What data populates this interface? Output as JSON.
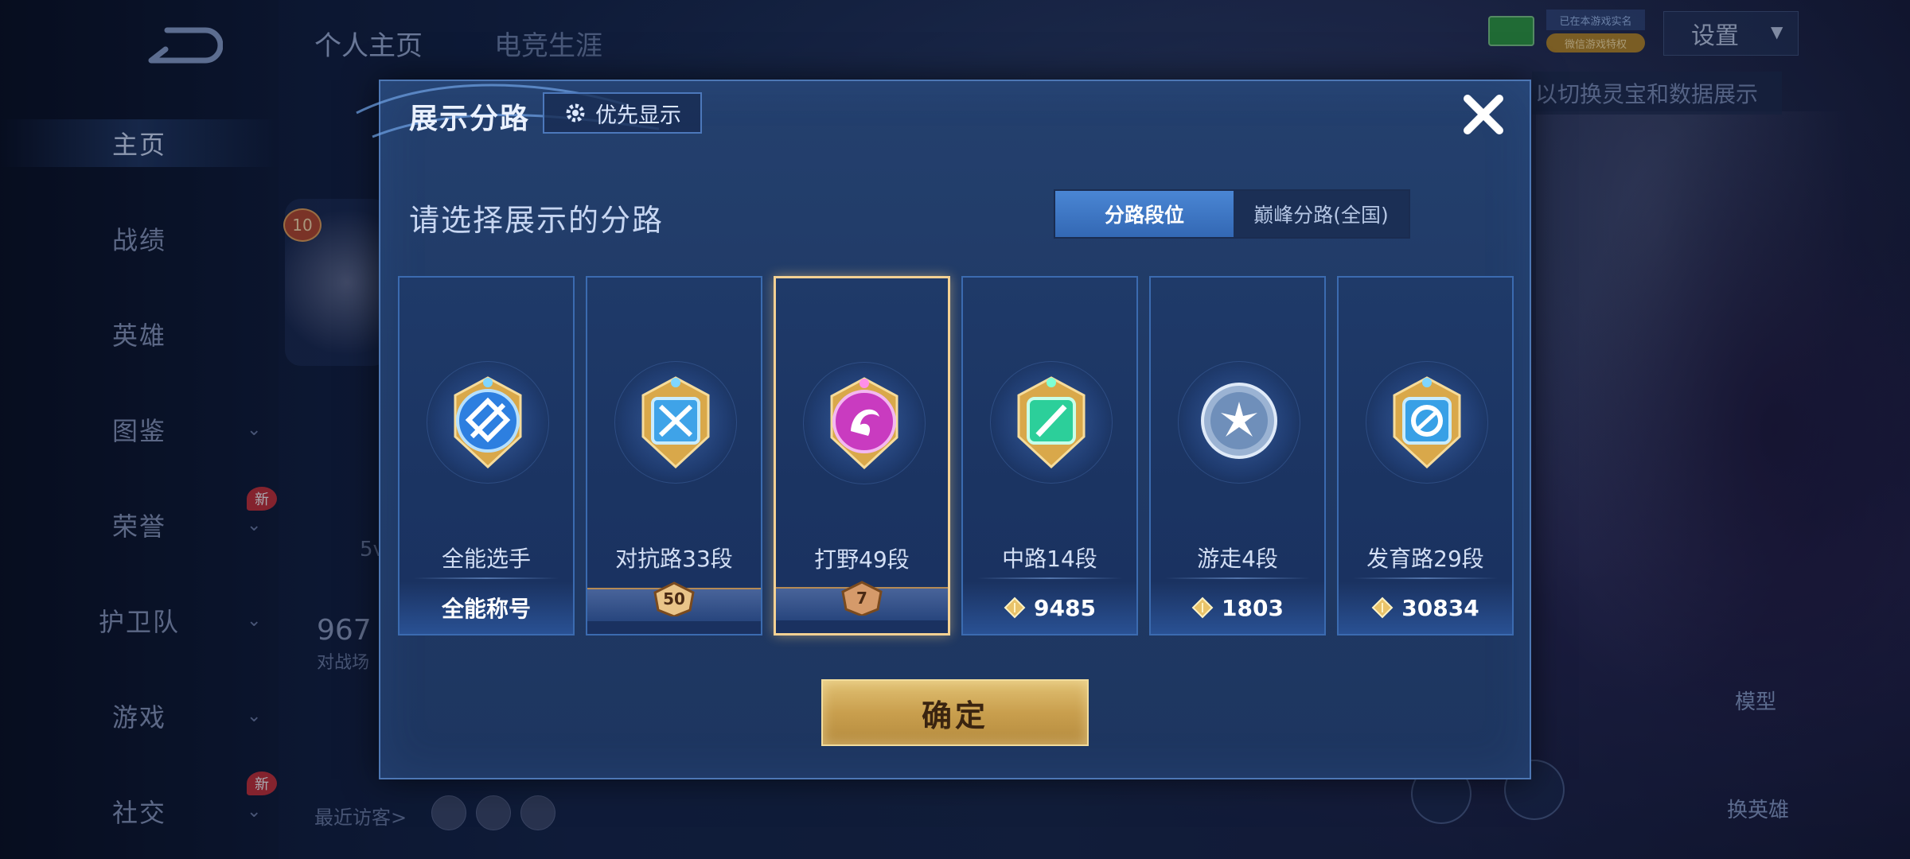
{
  "background": {
    "top_tabs": [
      "个人主页",
      "电竞生涯"
    ],
    "settings_label": "设置",
    "tag_top": "已在本游戏实名",
    "tag_bottom": "微信游戏特权",
    "hint_text": "以切换灵宝和数据展示",
    "nav_items": [
      {
        "label": "主页",
        "active": true
      },
      {
        "label": "战绩"
      },
      {
        "label": "英雄"
      },
      {
        "label": "图鉴",
        "caret": true
      },
      {
        "label": "荣誉",
        "caret": true,
        "new": true
      },
      {
        "label": "护卫队",
        "caret": true
      },
      {
        "label": "游戏",
        "caret": true
      },
      {
        "label": "社交",
        "caret": true,
        "new": true
      }
    ],
    "new_badge_label": "新",
    "level_badge": "10",
    "stat_value": "967",
    "stat_label": "对战场",
    "side_char": "5v",
    "recent_visitors": "最近访客>",
    "model_label": "模型",
    "switch_hero_label": "换英雄"
  },
  "dialog": {
    "title": "展示分路",
    "priority_button": "优先显示",
    "section_title": "请选择展示的分路",
    "toggle": {
      "active": "分路段位",
      "inactive": "巅峰分路(全国)"
    },
    "confirm": "确定",
    "cards": [
      {
        "label": "全能选手",
        "foot_text": "全能称号",
        "foot_type": "text",
        "badge_color": "#2d7fe0",
        "emblem": "allround"
      },
      {
        "label": "对抗路33段",
        "foot_text": "50",
        "foot_type": "rank",
        "badge_color": "#3fa3e8",
        "emblem": "sword"
      },
      {
        "label": "打野49段",
        "foot_text": "7",
        "foot_type": "rank",
        "badge_color": "#c93bc0",
        "emblem": "dragon",
        "selected": true
      },
      {
        "label": "中路14段",
        "foot_text": "9485",
        "foot_type": "points",
        "badge_color": "#2ccf9a",
        "emblem": "slash"
      },
      {
        "label": "游走4段",
        "foot_text": "1803",
        "foot_type": "points",
        "badge_color": "#8fb0d8",
        "emblem": "wings"
      },
      {
        "label": "发育路29段",
        "foot_text": "30834",
        "foot_type": "points",
        "badge_color": "#38a0e6",
        "emblem": "arrow"
      }
    ]
  }
}
